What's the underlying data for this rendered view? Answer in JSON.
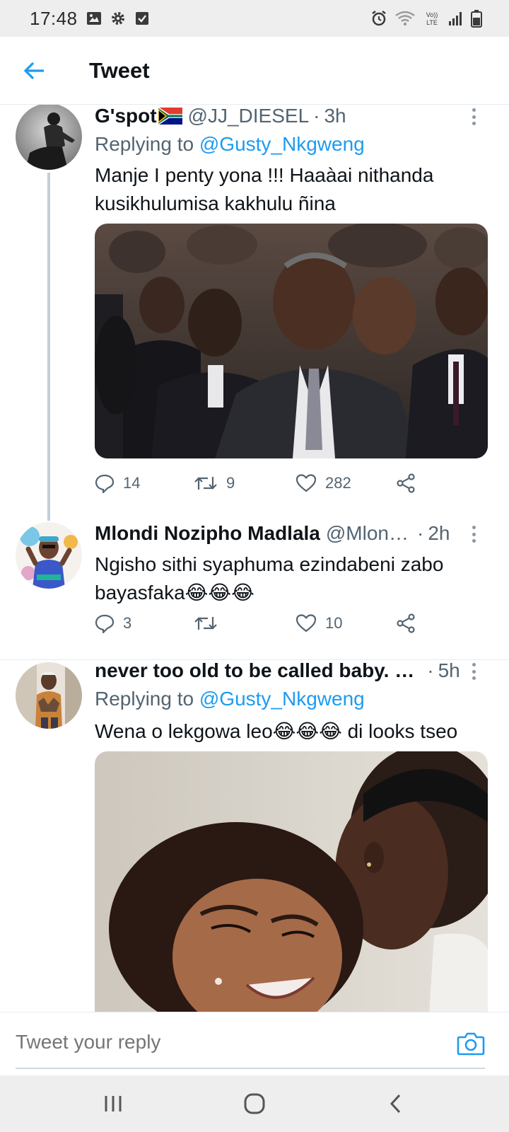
{
  "status_bar": {
    "time": "17:48",
    "left_icons": [
      "image-icon",
      "gear-icon",
      "checkbox-icon"
    ],
    "right_icons": [
      "alarm-icon",
      "wifi-icon",
      "volte-icon",
      "signal-icon",
      "battery-icon"
    ],
    "volte_label": "Vo)) LTE"
  },
  "header": {
    "back_icon": "back-arrow-icon",
    "title": "Tweet"
  },
  "tweets": [
    {
      "name": "G'spot",
      "flag": "south-africa-flag-icon",
      "handle": "@JJ_DIESEL",
      "separator": "·",
      "time": "3h",
      "replying_prefix": "Replying to",
      "replying_to": "@Gusty_Nkgweng",
      "text": "Manje I penty yona !!! Haaàai nithanda kusikhulumisa kakhulu ñina",
      "has_media": true,
      "stats": {
        "replies": "14",
        "retweets": "9",
        "likes": "282"
      }
    },
    {
      "name": "Mlondi Nozipho Madlala",
      "handle": "@Mlon…",
      "separator": "·",
      "time": "2h",
      "text": "Ngisho sithi syaphuma ezindabeni zabo bayasfaka😂😂😂",
      "has_media": false,
      "stats": {
        "replies": "3",
        "retweets": "",
        "likes": "10"
      }
    },
    {
      "name": "never too old to be called baby. …",
      "handle": "",
      "separator": "·",
      "time": "5h",
      "replying_prefix": "Replying to",
      "replying_to": "@Gusty_Nkgweng",
      "text": "Wena o lekgowa leo😂😂😂 di looks tseo",
      "has_media": true
    }
  ],
  "reply_bar": {
    "placeholder": "Tweet your reply",
    "camera_icon": "camera-icon"
  },
  "nav_bar": {
    "buttons": [
      "recent-apps-icon",
      "home-icon",
      "back-icon"
    ]
  },
  "colors": {
    "accent": "#1d9bf0",
    "text_secondary": "#536471",
    "divider": "#e6ecf0",
    "system_bar": "#eeeeee"
  }
}
